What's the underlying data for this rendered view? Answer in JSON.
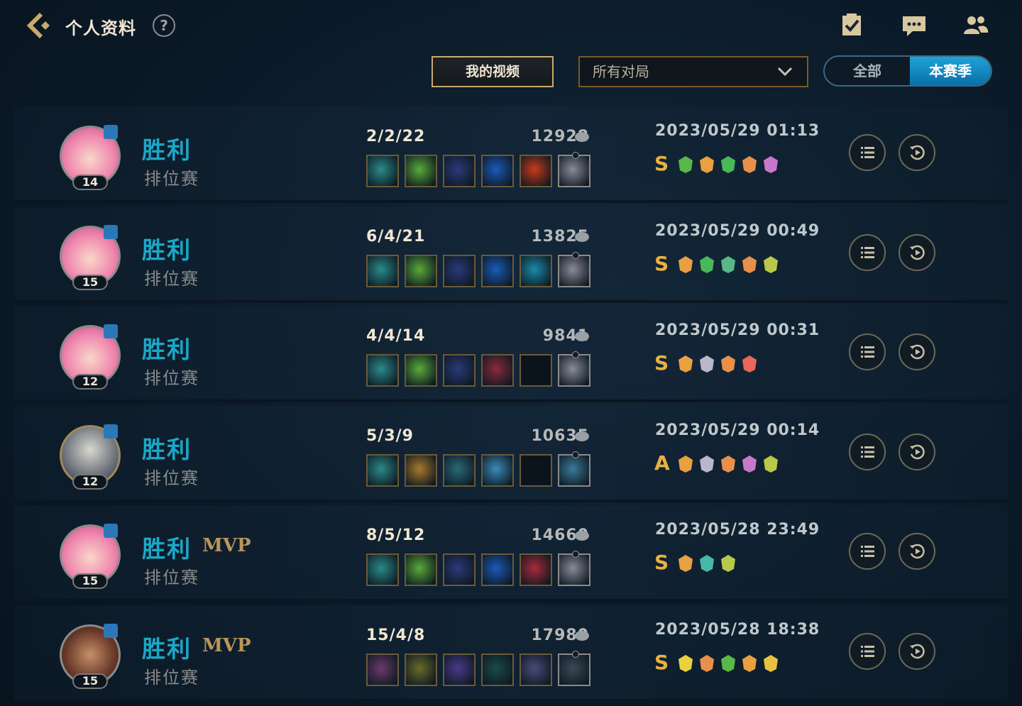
{
  "header": {
    "title": "个人资料",
    "help": "?"
  },
  "filters": {
    "video_label": "我的视频",
    "match_select": "所有对局",
    "segment": {
      "all": "全部",
      "season": "本赛季",
      "active": "season"
    }
  },
  "colors": {
    "gold": "#c8aa6e",
    "win": "#1aa8c8",
    "mvp": "#b8965a",
    "grade": "#e8b040",
    "accent_blue": "#1ea3d8"
  },
  "matches": [
    {
      "result": "胜利",
      "mvp": "",
      "queue": "排位赛",
      "level": "14",
      "avatar": "pink-hair-champion",
      "kda": "2/2/22",
      "gold": "12928",
      "date": "2023/05/29 01:13",
      "grade": "S",
      "items": [
        "hook-item-icon",
        "green-leaf-item-icon",
        "blue-blade-item-icon",
        "blue-serpent-item-icon",
        "red-orb-item-icon",
        "trinket-flag-icon"
      ],
      "item_colors": [
        "#2a8a8a",
        "#5aaa3a",
        "#2a3a7a",
        "#1a5ab8",
        "#c83a1a",
        "#8a8a9a"
      ],
      "badges": [
        "#58b848",
        "#e8a040",
        "#48b858",
        "#e8904a",
        "#c878c8"
      ]
    },
    {
      "result": "胜利",
      "mvp": "",
      "queue": "排位赛",
      "level": "15",
      "avatar": "pink-hair-champion",
      "kda": "6/4/21",
      "gold": "13825",
      "date": "2023/05/29 00:49",
      "grade": "S",
      "items": [
        "hook-item-icon",
        "green-leaf-item-icon",
        "blue-blade-item-icon",
        "blue-serpent-item-icon",
        "teal-spirit-item-icon",
        "trinket-flag-icon"
      ],
      "item_colors": [
        "#2a8a8a",
        "#5aaa3a",
        "#2a3a7a",
        "#1a5ab8",
        "#1a8aa8",
        "#8a8a9a"
      ],
      "badges": [
        "#e8a040",
        "#48b858",
        "#58b888",
        "#e8904a",
        "#b8c848"
      ]
    },
    {
      "result": "胜利",
      "mvp": "",
      "queue": "排位赛",
      "level": "12",
      "avatar": "pink-hair-champion",
      "kda": "4/4/14",
      "gold": "9841",
      "date": "2023/05/29 00:31",
      "grade": "S",
      "items": [
        "hook-item-icon",
        "green-leaf-item-icon",
        "blue-blade-item-icon",
        "red-book-item-icon",
        "empty-item-slot",
        "trinket-flag-icon"
      ],
      "item_colors": [
        "#2a8a8a",
        "#5aaa3a",
        "#2a3a7a",
        "#8a2a3a",
        "#0b141c",
        "#8a8a9a"
      ],
      "badges": [
        "#e8a040",
        "#b8b8c8",
        "#e8904a",
        "#e86858"
      ]
    },
    {
      "result": "胜利",
      "mvp": "",
      "queue": "排位赛",
      "level": "12",
      "avatar": "armored-champion",
      "kda": "5/3/9",
      "gold": "10635",
      "date": "2023/05/29 00:14",
      "grade": "A",
      "items": [
        "hook-item-icon",
        "gold-armor-item-icon",
        "teal-plate-item-icon",
        "round-shield-item-icon",
        "empty-item-slot",
        "trinket-lantern-icon"
      ],
      "item_colors": [
        "#2a8a8a",
        "#a8782a",
        "#2a6a7a",
        "#3a8ab8",
        "#0b141c",
        "#3a7a9a"
      ],
      "badges": [
        "#e8a040",
        "#b8b8c8",
        "#e8904a",
        "#c878c8",
        "#b8c848"
      ]
    },
    {
      "result": "胜利",
      "mvp": "MVP",
      "queue": "排位赛",
      "level": "15",
      "avatar": "pink-hair-champion",
      "kda": "8/5/12",
      "gold": "14660",
      "date": "2023/05/28 23:49",
      "grade": "S",
      "items": [
        "hook-item-icon",
        "green-leaf-item-icon",
        "blue-blade-item-icon",
        "blue-serpent-item-icon",
        "red-mask-item-icon",
        "trinket-flag-icon"
      ],
      "item_colors": [
        "#2a8a8a",
        "#5aaa3a",
        "#2a3a7a",
        "#1a5ab8",
        "#a82a3a",
        "#8a8a9a"
      ],
      "badges": [
        "#e8a040",
        "#48b8a8",
        "#b8c848"
      ]
    },
    {
      "result": "胜利",
      "mvp": "MVP",
      "queue": "排位赛",
      "level": "15",
      "avatar": "brown-hair-champion",
      "kda": "15/4/8",
      "gold": "17980",
      "date": "2023/05/28 18:38",
      "grade": "S",
      "items": [
        "purple-claw-item-icon",
        "yellow-blade-item-icon",
        "violet-spear-item-icon",
        "teal-arrow-item-icon",
        "purple-helm-item-icon",
        "trinket-orb-icon"
      ],
      "item_colors": [
        "#6a3a6a",
        "#6a6a2a",
        "#4a3a8a",
        "#1a4a4a",
        "#4a4a7a",
        "#3a4a5a"
      ],
      "badges": [
        "#e8d040",
        "#e8904a",
        "#58b848",
        "#e8a040",
        "#e8c040"
      ]
    }
  ]
}
